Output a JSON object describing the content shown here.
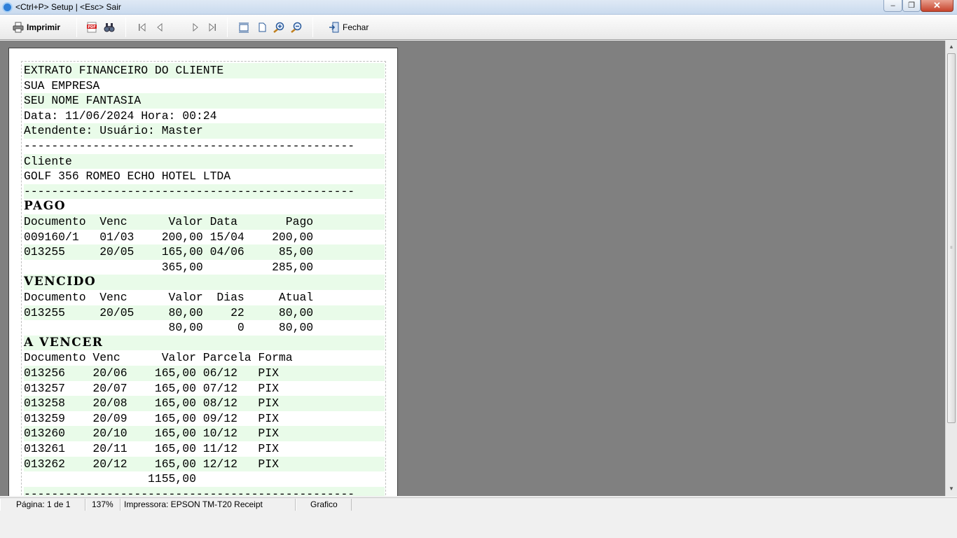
{
  "window": {
    "title": "<Ctrl+P> Setup | <Esc> Sair",
    "minimize": "–",
    "maximize": "❐",
    "close": "✕"
  },
  "toolbar": {
    "print_label": "Imprimir",
    "close_label": "Fechar"
  },
  "receipt": {
    "lines": [
      {
        "text": "EXTRATO FINANCEIRO DO CLIENTE",
        "band": true
      },
      {
        "text": "SUA EMPRESA",
        "band": false
      },
      {
        "text": "SEU NOME FANTASIA",
        "band": true
      },
      {
        "text": "Data: 11/06/2024 Hora: 00:24",
        "band": false
      },
      {
        "text": "Atendente: Usuário: Master",
        "band": true
      },
      {
        "text": "------------------------------------------------",
        "band": false
      },
      {
        "text": "Cliente",
        "band": true
      },
      {
        "text": "GOLF 356 ROMEO ECHO HOTEL LTDA",
        "band": false
      },
      {
        "text": "------------------------------------------------",
        "band": true
      },
      {
        "text": "PAGO",
        "band": false,
        "heading": true
      },
      {
        "text": "Documento  Venc      Valor Data       Pago",
        "band": true
      },
      {
        "text": "009160/1   01/03    200,00 15/04    200,00",
        "band": false
      },
      {
        "text": "013255     20/05    165,00 04/06     85,00",
        "band": true
      },
      {
        "text": "                    365,00          285,00",
        "band": false
      },
      {
        "text": "VENCIDO",
        "band": true,
        "heading": true
      },
      {
        "text": "Documento  Venc      Valor  Dias     Atual",
        "band": false
      },
      {
        "text": "013255     20/05     80,00    22     80,00",
        "band": true
      },
      {
        "text": "                     80,00     0     80,00",
        "band": false
      },
      {
        "text": "A VENCER",
        "band": true,
        "heading": true
      },
      {
        "text": "Documento Venc      Valor Parcela Forma",
        "band": false
      },
      {
        "text": "013256    20/06    165,00 06/12   PIX",
        "band": true
      },
      {
        "text": "013257    20/07    165,00 07/12   PIX",
        "band": false
      },
      {
        "text": "013258    20/08    165,00 08/12   PIX",
        "band": true
      },
      {
        "text": "013259    20/09    165,00 09/12   PIX",
        "band": false
      },
      {
        "text": "013260    20/10    165,00 10/12   PIX",
        "band": true
      },
      {
        "text": "013261    20/11    165,00 11/12   PIX",
        "band": false
      },
      {
        "text": "013262    20/12    165,00 12/12   PIX",
        "band": true
      },
      {
        "text": "                  1155,00",
        "band": false
      },
      {
        "text": "------------------------------------------------",
        "band": true
      }
    ]
  },
  "statusbar": {
    "page": "Página: 1 de 1",
    "zoom": "137%",
    "printer": "Impressora: EPSON TM-T20 Receipt",
    "mode": "Grafico"
  },
  "colors": {
    "band": "#e9fbe9",
    "preview_bg": "#808080"
  }
}
